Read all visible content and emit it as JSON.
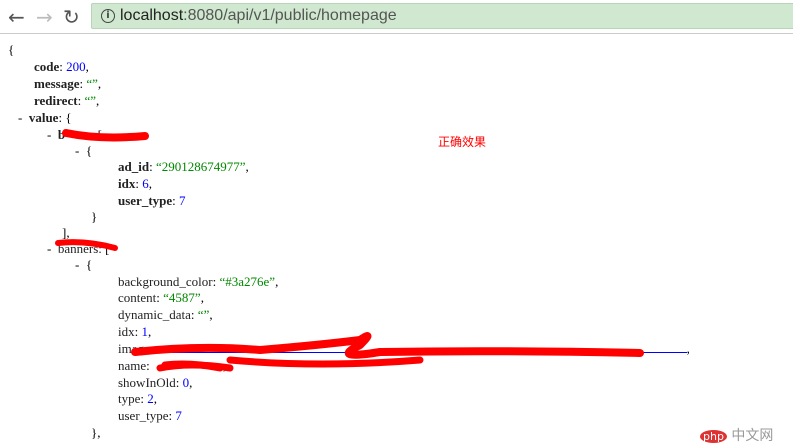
{
  "browser": {
    "url_host": "localhost",
    "url_rest": ":8080/api/v1/public/homepage",
    "back": "←",
    "forward": "→",
    "reload": "↻",
    "info": "i"
  },
  "json": {
    "open": "{",
    "code_key": "code",
    "code_val": "200",
    "message_key": "message",
    "message_val": "“”",
    "redirect_key": "redirect",
    "redirect_val": "“”",
    "value_key": "value",
    "ad": {
      "ad_id_key": "ad_id",
      "ad_id_val": "“290128674977”",
      "idx_key": "idx",
      "idx_val": "6",
      "user_type_key": "user_type",
      "user_type_val": "7"
    },
    "banner": {
      "background_color_key": "background_color",
      "background_color_val": "“#3a276e”",
      "content_key": "content",
      "content_val": "“4587”",
      "dynamic_data_key": "dynamic_data",
      "dynamic_data_val": "“”",
      "idx_key": "idx",
      "idx_val": "1",
      "image_key": "image",
      "name_key": "name",
      "showInOld_key": "showInOld",
      "showInOld_val": "0",
      "type_key": "type",
      "type_val": "2",
      "user_type_key": "user_type",
      "user_type_val": "7"
    }
  },
  "annotation": "正确效果",
  "watermark": {
    "badge": "php",
    "text": "中文网"
  }
}
